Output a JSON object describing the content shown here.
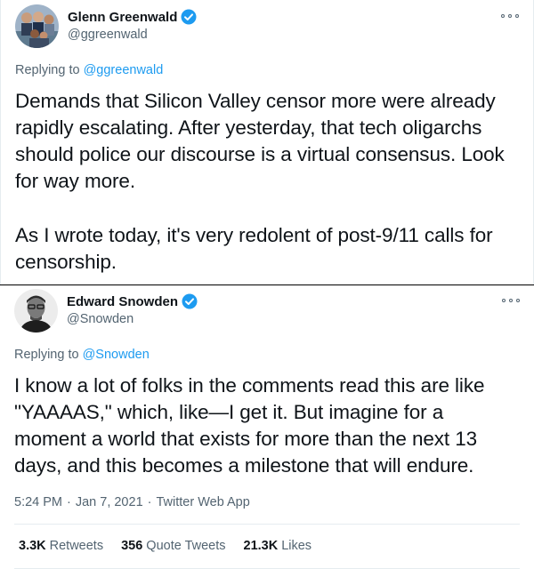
{
  "tweets": [
    {
      "display_name": "Glenn Greenwald",
      "handle": "@ggreenwald",
      "replying_prefix": "Replying to",
      "replying_handle": "@ggreenwald",
      "paragraphs": [
        "Demands that Silicon Valley censor more were already rapidly escalating. After yesterday, that tech oligarchs should police our discourse is a virtual consensus. Look for way more.",
        "As I wrote today, it's very redolent of post-9/11 calls for censorship."
      ]
    },
    {
      "display_name": "Edward Snowden",
      "handle": "@Snowden",
      "replying_prefix": "Replying to",
      "replying_handle": "@Snowden",
      "paragraphs": [
        "I know a lot of folks in the comments read this are like \"YAAAAS,\" which, like—I get it. But imagine for a moment a world that exists for more than the next 13 days, and this becomes a milestone that will endure."
      ],
      "time": "5:24 PM",
      "date": "Jan 7, 2021",
      "source": "Twitter Web App",
      "stats": {
        "retweets_count": "3.3K",
        "retweets_label": "Retweets",
        "quotes_count": "356",
        "quotes_label": "Quote Tweets",
        "likes_count": "21.3K",
        "likes_label": "Likes"
      }
    }
  ],
  "separator": "·",
  "colors": {
    "accent": "#1d9bf0",
    "text": "#0f1419",
    "secondary": "#536471",
    "border": "#e6ecf0"
  },
  "icons": {
    "verified": "verified-badge-icon",
    "more": "more-options-icon"
  }
}
